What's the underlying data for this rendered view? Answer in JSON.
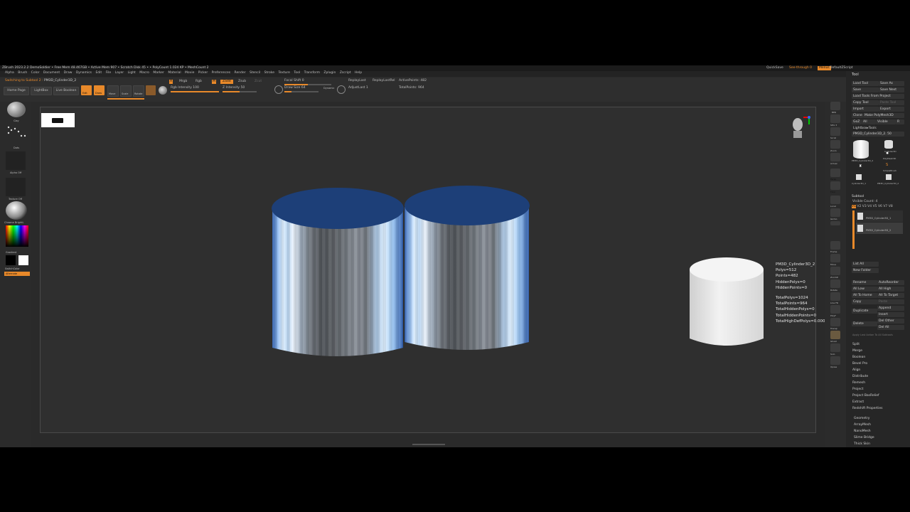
{
  "titlebar": {
    "text": "ZBrush 2023.2.2   DemoSoldier   • Free Mem 48.467GB • Active Mem 907 • Scratch Disk 45 • • PolyCount 1.024 KP • MeshCount 2",
    "quicksave": "QuickSave",
    "seethrough": "See-through 0",
    "menus": "Menus",
    "defaultzscript": "DefaultZScript"
  },
  "menubar": {
    "items": [
      "Alpha",
      "Brush",
      "Color",
      "Document",
      "Draw",
      "Dynamics",
      "Edit",
      "File",
      "Layer",
      "Light",
      "Macro",
      "Marker",
      "Material",
      "Movie",
      "Picker",
      "Preferences",
      "Render",
      "Stencil",
      "Stroke",
      "Texture",
      "Tool",
      "Transform",
      "Zplugin",
      "Zscript",
      "Help"
    ]
  },
  "status": {
    "message": "Switching to Subtool 2 :",
    "subtool_name": "PM3D_Cylinder3D_2"
  },
  "toolbar": {
    "home_page": "Home Page",
    "lightbox": "LightBox",
    "live_boolean": "Live Boolean",
    "edit": "Edit",
    "draw": "Draw",
    "move": "Move",
    "scale": "Scale",
    "rotate": "Rotate",
    "a": "A",
    "mrgb": "Mrgb",
    "rgb": "Rgb",
    "m": "M",
    "zadd": "Zadd",
    "zsub": "Zsub",
    "zcut": "Zcut",
    "rgb_intensity": "Rgb Intensity 100",
    "z_intensity": "Z Intensity 50",
    "focal_shift": "Focal Shift 0",
    "draw_size": "Draw Size 64",
    "dynamic": "Dynamic",
    "replay_last": "ReplayLast",
    "replay_last_rel": "ReplayLastRel",
    "adjust_last": "AdjustLast 1",
    "active_points": "ActivePoints: 482",
    "total_points": "TotalPoints: 964"
  },
  "left_shelf": {
    "brush": "Clay",
    "stroke": "Dots",
    "alpha": "Alpha Off",
    "texture": "Texture Off",
    "material": "Chrome BrightL",
    "gradient": "Gradient",
    "switch_color": "SwitchColor",
    "alternate": "Alternate"
  },
  "viewport_info": {
    "name": "PM3D_Cylinder3D_2",
    "polys": "Polys=512",
    "points": "Points=482",
    "hidden_polys": "HiddenPolys=0",
    "hidden_points": "HiddenPoints=0",
    "total_polys": "TotalPolys=1024",
    "total_points": "TotalPoints=964",
    "total_hidden_polys": "TotalHiddenPolys=0",
    "total_hidden_points": "TotalHiddenPoints=0",
    "total_highdef": "TotalHighDefPolys=0.0000000 Mil"
  },
  "right_shelf": [
    "BPR",
    "SPix 3",
    "Scroll",
    "Zoom",
    "Actual",
    "AAHalf",
    "Persp",
    "Floor",
    "Local",
    "Gizmo",
    "Frame",
    "Move",
    "ZoomD",
    "Rotate",
    "Line Fill",
    "PolyF",
    "Transp",
    "Ghost",
    "Solo",
    "Xpose"
  ],
  "tool_panel": {
    "header": "Tool",
    "row1": [
      "Load Tool",
      "Save As"
    ],
    "row2": [
      "Save",
      "Save Next"
    ],
    "row3": [
      "Load Tools From Project"
    ],
    "row4": [
      "Copy Tool",
      "Paste Tool"
    ],
    "row5": [
      "Import",
      "Export"
    ],
    "row6": [
      "Clone",
      "Make PolyMesh3D"
    ],
    "row7": [
      "GoZ",
      "All",
      "Visible",
      "R"
    ],
    "row8": [
      "Lightbox▸Tools"
    ],
    "current_tool": "PM3D_Cylinder3D_2. 50",
    "thumbs": [
      "PM3D_Cylinder3D_2",
      "Cylinder3D",
      "PolyMesh3D",
      "SimpleBrush",
      "Cylinder3D_1",
      "PM3D_Cylinder3D_2"
    ],
    "subtool_header": "Subtool",
    "visible_count": "Visible Count: 4",
    "v_tabs": [
      "V1",
      "V2",
      "V3",
      "V4",
      "V5",
      "V6",
      "V7",
      "V8"
    ],
    "subtools": [
      "PM3D_Cylinder3D_1",
      "PM3D_Cylinder3D_2"
    ],
    "list_all": "List All",
    "new_folder": "New Folder",
    "actions_left": [
      "Rename",
      "All Low",
      "All To Home",
      "Copy",
      "Duplicate",
      "Delete"
    ],
    "actions_right": [
      "AutoReorder",
      "All High",
      "All To Target",
      "Paste",
      "Append",
      "Insert",
      "Del Other",
      "Del All"
    ],
    "apply_note": "Apply Last Action To All Subtools",
    "menu": [
      "Split",
      "Merge",
      "Boolean",
      "Bevel Pro",
      "Align",
      "Distribute",
      "Remesh",
      "Project",
      "Project BasRelief",
      "Extract",
      "Redshift Properties"
    ],
    "bottom": [
      "Geometry",
      "ArrayMesh",
      "NanoMesh",
      "Slime Bridge",
      "Thick Skin"
    ]
  },
  "colors": {
    "accent": "#e8892a",
    "cap": "#1d3f78",
    "panel": "#262626",
    "canvas": "#2f2f2f"
  }
}
